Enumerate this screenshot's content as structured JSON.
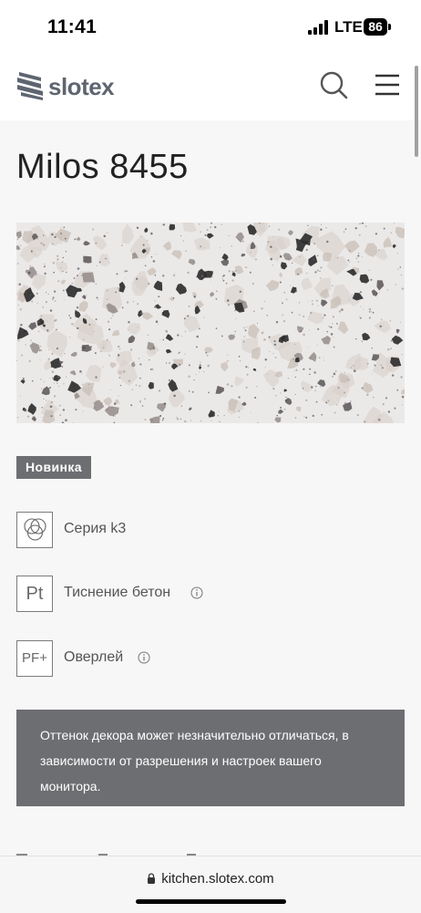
{
  "status_bar": {
    "time": "11:41",
    "network": "LTE",
    "battery": "86",
    "icons": [
      "signal-bars-icon",
      "battery-icon"
    ]
  },
  "header": {
    "logo_text": "slotex",
    "icons": [
      "slotex-logo-mark",
      "search-icon",
      "hamburger-menu-icon"
    ]
  },
  "product": {
    "title": "Milos 8455",
    "badge": "Новинка",
    "swatch": {
      "base_color": "#ebe9e8",
      "chip_colors": [
        "#2b2a2b",
        "#8e8683",
        "#c8bdb6",
        "#d7cdc7",
        "#5a5456"
      ]
    }
  },
  "features": [
    {
      "icon": "series-circles-icon",
      "label": "Серия k3",
      "has_info": false
    },
    {
      "icon_text": "Pt",
      "label": "Тиснение бетон",
      "has_info": true
    },
    {
      "icon_text": "PF+",
      "label": "Оверлей",
      "has_info": true
    }
  ],
  "disclaimer": {
    "text": "Оттенок декора может незначительно отличаться, в зависимости от разрешения и настроек вашего монитора."
  },
  "browser": {
    "url": "kitchen.slotex.com"
  },
  "colors": {
    "page_background": "#f7f7f7",
    "header_background": "#ffffff",
    "badge_background": "#6d6e71",
    "disclaimer_background": "#6d6e71",
    "logo_grey": "#5e6570"
  }
}
